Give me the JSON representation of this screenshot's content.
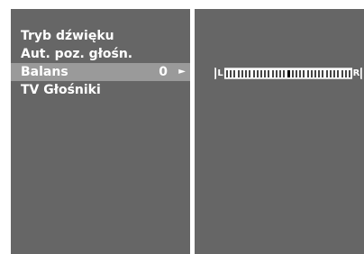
{
  "menu": {
    "items": [
      {
        "label": "Tryb dźwięku",
        "value": "",
        "arrow": ""
      },
      {
        "label": "Aut. poz. głośn.",
        "value": "",
        "arrow": ""
      },
      {
        "label": "Balans",
        "value": "0",
        "arrow": "►"
      },
      {
        "label": "TV Głośniki",
        "value": "",
        "arrow": ""
      }
    ],
    "selected_index": 2
  },
  "balance": {
    "left_label": "L",
    "right_label": "R",
    "value": 0
  },
  "colors": {
    "panel": "#666666",
    "selected": "#9a9a9a",
    "text": "#ffffff"
  }
}
